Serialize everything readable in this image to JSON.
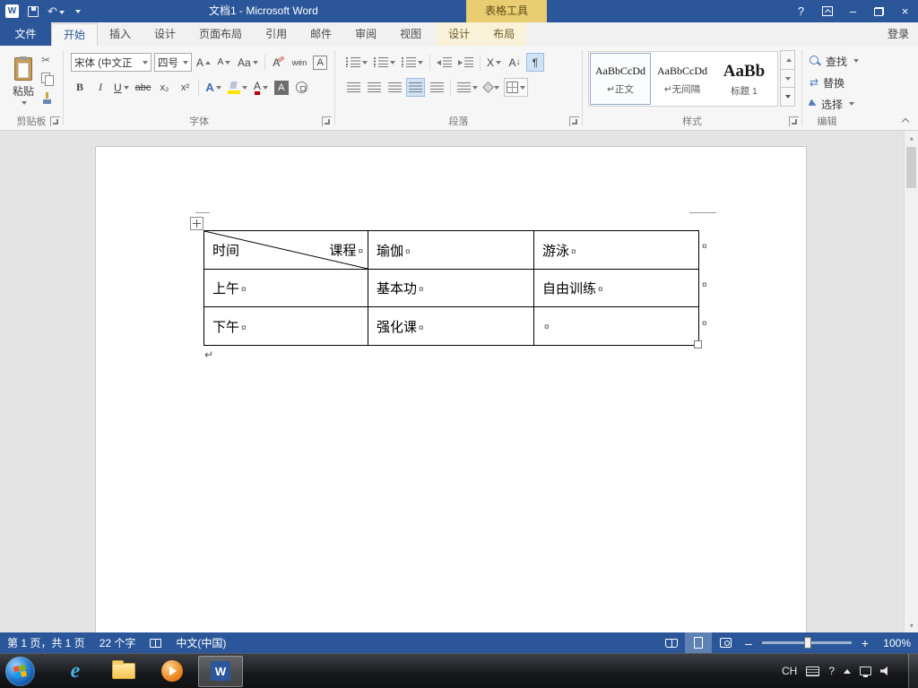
{
  "colors": {
    "accent": "#2b579a",
    "context_gold": "#e8cd72",
    "status_bar": "#2b579a",
    "font_color_bar": "#c00000",
    "highlight_bar": "#ffe400"
  },
  "icons": {
    "scissors": "✂",
    "undo": "↶",
    "sort_arrow": "↓",
    "swap_arrows": "⇄",
    "pilcrow": "¶",
    "up_arrow": "▲",
    "down_arrow": "▼",
    "help": "?"
  },
  "titlebar": {
    "title": "文档1 - Microsoft Word",
    "context_label": "表格工具",
    "help_icon": "?",
    "minimize_icon": "–",
    "close_icon": "×"
  },
  "tabs": {
    "file": "文件",
    "main": [
      "开始",
      "插入",
      "设计",
      "页面布局",
      "引用",
      "邮件",
      "审阅",
      "视图"
    ],
    "contextual": [
      "设计",
      "布局"
    ],
    "sign_in": "登录"
  },
  "clipboard": {
    "label": "剪贴板",
    "paste": "粘贴"
  },
  "font_group": {
    "label": "字体",
    "font_name": "宋体 (中文正",
    "font_size": "四号",
    "grow": "A",
    "shrink": "A",
    "case_btn": "Aa",
    "clear": "A",
    "phonetic": "wén",
    "char_border": "A",
    "bold": "B",
    "italic": "I",
    "underline": "U",
    "strike": "abc",
    "subscript": "x₂",
    "superscript": "x²",
    "effects": "A",
    "font_color": "A",
    "char_shading": "A"
  },
  "paragraph_group": {
    "label": "段落",
    "sort_letter": "A",
    "asian_layout": "X"
  },
  "styles_group": {
    "label": "样式",
    "styles": [
      {
        "preview": "AaBbCcDd",
        "name": "↵正文"
      },
      {
        "preview": "AaBbCcDd",
        "name": "↵无间隔"
      },
      {
        "preview": "AaBb",
        "name": "标题 1"
      }
    ]
  },
  "editing_group": {
    "label": "编辑",
    "find": "查找",
    "replace": "替换",
    "select": "选择"
  },
  "document": {
    "table": {
      "diagonal": {
        "left": "时间",
        "right": "课程"
      },
      "rows": [
        [
          "",
          "瑜伽",
          "游泳"
        ],
        [
          "上午",
          "基本功",
          "自由训练"
        ],
        [
          "下午",
          "强化课",
          ""
        ]
      ],
      "cell_mark": "¤",
      "para_mark": "↵"
    }
  },
  "statusbar": {
    "page_info": "第 1 页，共 1 页",
    "word_count": "22 个字",
    "language": "中文(中国)",
    "zoom_minus": "–",
    "zoom_plus": "+",
    "zoom_level": "100%"
  },
  "taskbar": {
    "tray_language": "CH",
    "word_initial": "W"
  }
}
